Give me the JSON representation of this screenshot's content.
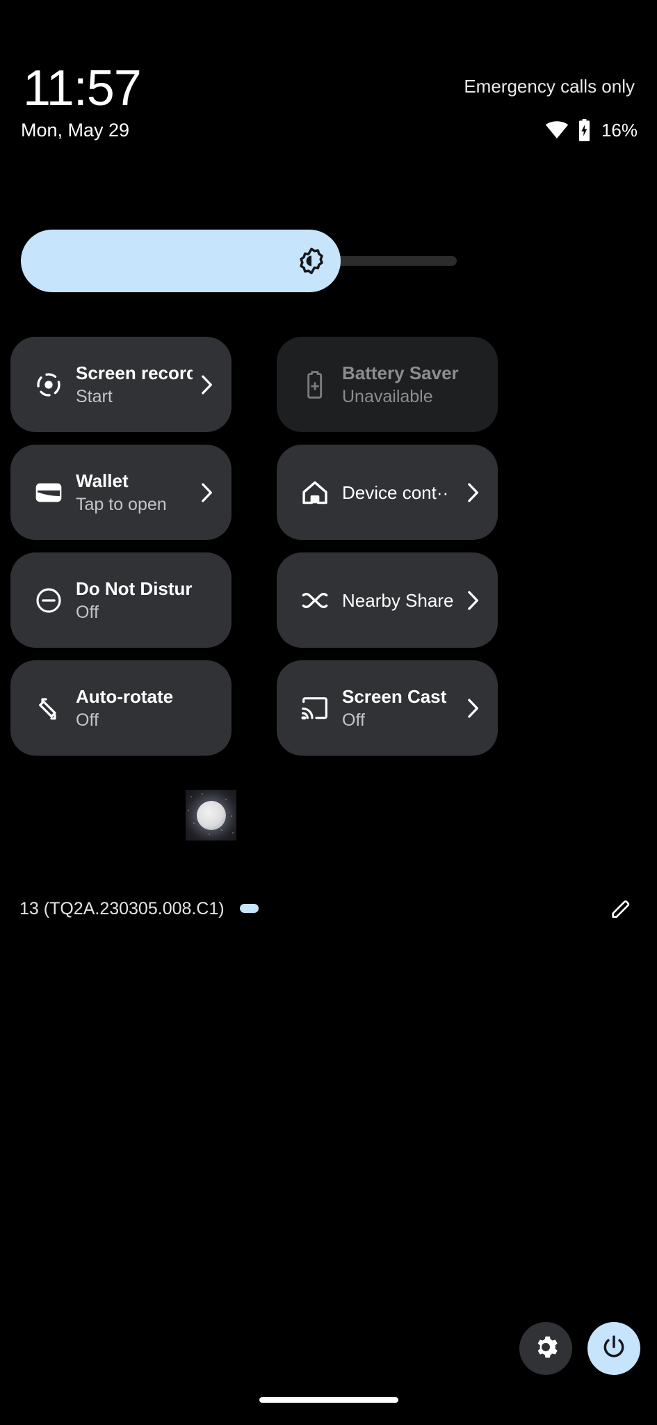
{
  "statusbar": {
    "time": "11:57",
    "carrier": "Emergency calls only",
    "date": "Mon, May 29",
    "battery_percent": "16%",
    "wifi_icon": "wifi-icon",
    "battery_icon": "battery-charging-icon"
  },
  "brightness": {
    "icon": "brightness-icon",
    "fill_percent": 73,
    "accent_color": "#c6e4fb",
    "track_color": "#2c2c2c"
  },
  "tiles": [
    {
      "name": "screen-record",
      "icon": "screen-record-icon",
      "title": "Screen record",
      "subtitle": "Start",
      "chevron": true,
      "enabled": true,
      "column": "left"
    },
    {
      "name": "battery-saver",
      "icon": "battery-saver-icon",
      "title": "Battery Saver",
      "subtitle": "Unavailable",
      "chevron": false,
      "enabled": false,
      "column": "right"
    },
    {
      "name": "wallet",
      "icon": "wallet-icon",
      "title": "Wallet",
      "subtitle": "Tap to open",
      "chevron": true,
      "enabled": true,
      "column": "left"
    },
    {
      "name": "device-controls",
      "icon": "home-icon",
      "title": "Device cont··",
      "subtitle": "",
      "chevron": true,
      "enabled": true,
      "column": "right"
    },
    {
      "name": "do-not-disturb",
      "icon": "do-not-disturb-icon",
      "title": "Do Not Disturb",
      "subtitle": "Off",
      "chevron": false,
      "enabled": true,
      "column": "left"
    },
    {
      "name": "nearby-share",
      "icon": "nearby-share-icon",
      "title": "Nearby Share",
      "subtitle": "",
      "chevron": true,
      "enabled": true,
      "column": "right"
    },
    {
      "name": "auto-rotate",
      "icon": "auto-rotate-icon",
      "title": "Auto-rotate",
      "subtitle": "Off",
      "chevron": false,
      "enabled": true,
      "column": "left"
    },
    {
      "name": "screen-cast",
      "icon": "screen-cast-icon",
      "title": "Screen Cast",
      "subtitle": "Off",
      "chevron": true,
      "enabled": true,
      "column": "right"
    }
  ],
  "footer": {
    "build_label": "13 (TQ2A.230305.008.C1)",
    "page_count": 1,
    "active_page": 1,
    "edit_icon": "pencil-icon"
  },
  "bottom_actions": {
    "settings_icon": "gear-icon",
    "power_icon": "power-icon"
  },
  "overlay_thumbnail": {
    "name": "moon-thumbnail",
    "description": "glowing orb on starfield"
  }
}
